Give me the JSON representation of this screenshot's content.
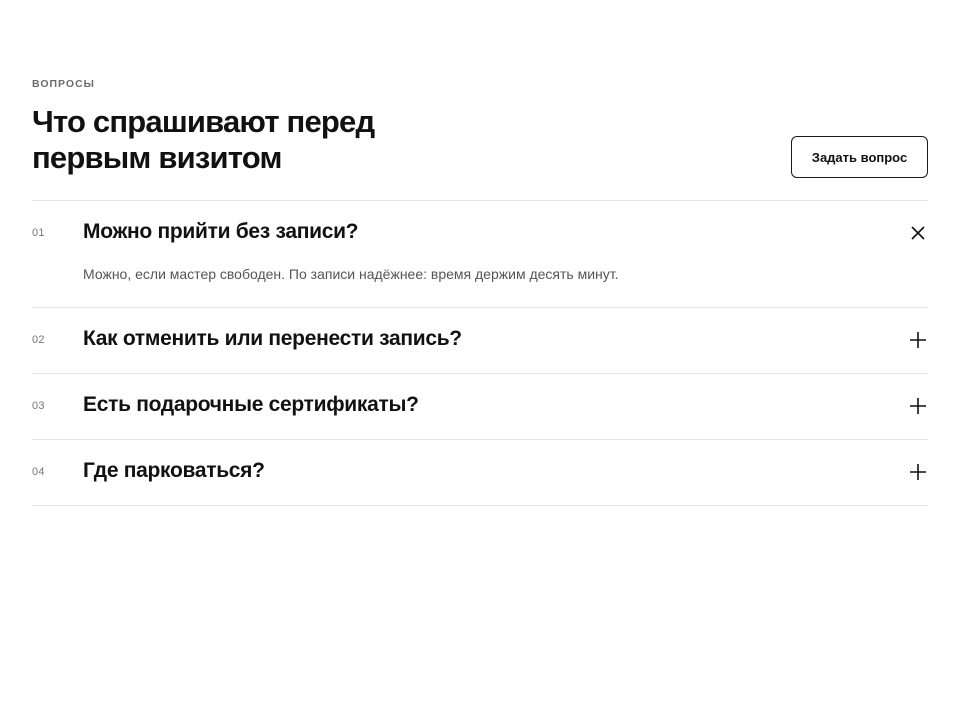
{
  "section": {
    "eyebrow": "ВОПРОСЫ",
    "title": "Что спрашивают перед первым визитом",
    "ask_button": "Задать вопрос"
  },
  "faq": [
    {
      "num": "01",
      "question": "Можно прийти без записи?",
      "answer": "Можно, если мастер свободен. По записи надёжнее: время держим десять минут.",
      "open": true,
      "icon": "close-icon"
    },
    {
      "num": "02",
      "question": "Как отменить или перенести запись?",
      "open": false,
      "icon": "plus-icon"
    },
    {
      "num": "03",
      "question": "Есть подарочные сертификаты?",
      "open": false,
      "icon": "plus-icon"
    },
    {
      "num": "04",
      "question": "Где парковаться?",
      "open": false,
      "icon": "plus-icon"
    }
  ]
}
